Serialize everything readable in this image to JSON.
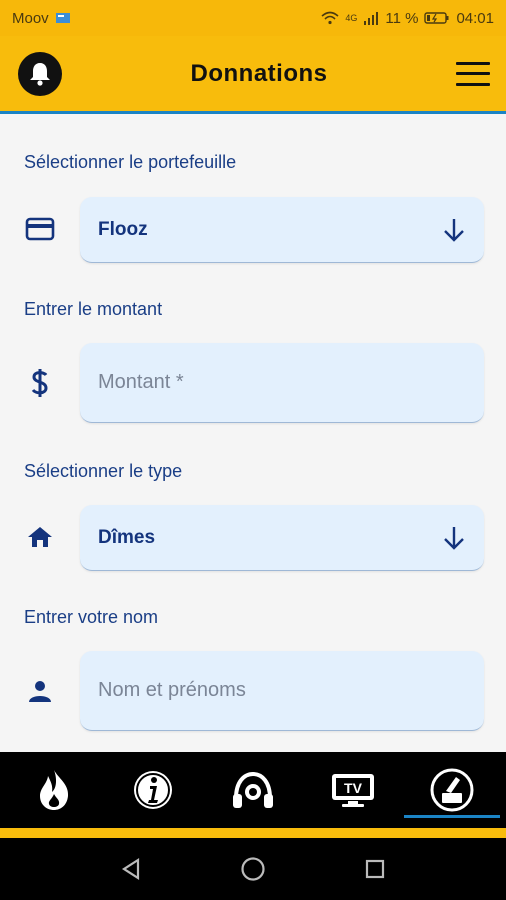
{
  "status_bar": {
    "carrier": "Moov",
    "network": "4G",
    "battery": "11 %",
    "time": "04:01"
  },
  "header": {
    "title": "Donnations"
  },
  "form": {
    "wallet": {
      "label": "Sélectionner le portefeuille",
      "value": "Flooz",
      "icon": "credit-card-icon"
    },
    "amount": {
      "label": "Entrer le montant",
      "placeholder": "Montant *",
      "icon": "dollar-icon"
    },
    "type": {
      "label": "Sélectionner le type",
      "value": "Dîmes",
      "icon": "home-icon"
    },
    "name": {
      "label": "Entrer votre nom",
      "placeholder": "Nom et prénoms",
      "icon": "person-icon"
    }
  },
  "bottom_nav": {
    "items": [
      {
        "name": "flame",
        "icon": "flame-icon"
      },
      {
        "name": "info",
        "icon": "info-icon"
      },
      {
        "name": "radio",
        "icon": "headphones-icon"
      },
      {
        "name": "tv",
        "icon": "tv-icon",
        "label": "TV"
      },
      {
        "name": "donation",
        "icon": "donation-icon",
        "active": true
      }
    ]
  },
  "colors": {
    "accent": "#f8bc0c",
    "primary_text": "#14347d",
    "field_bg": "#e3f0fd",
    "indicator": "#1b84c5"
  }
}
